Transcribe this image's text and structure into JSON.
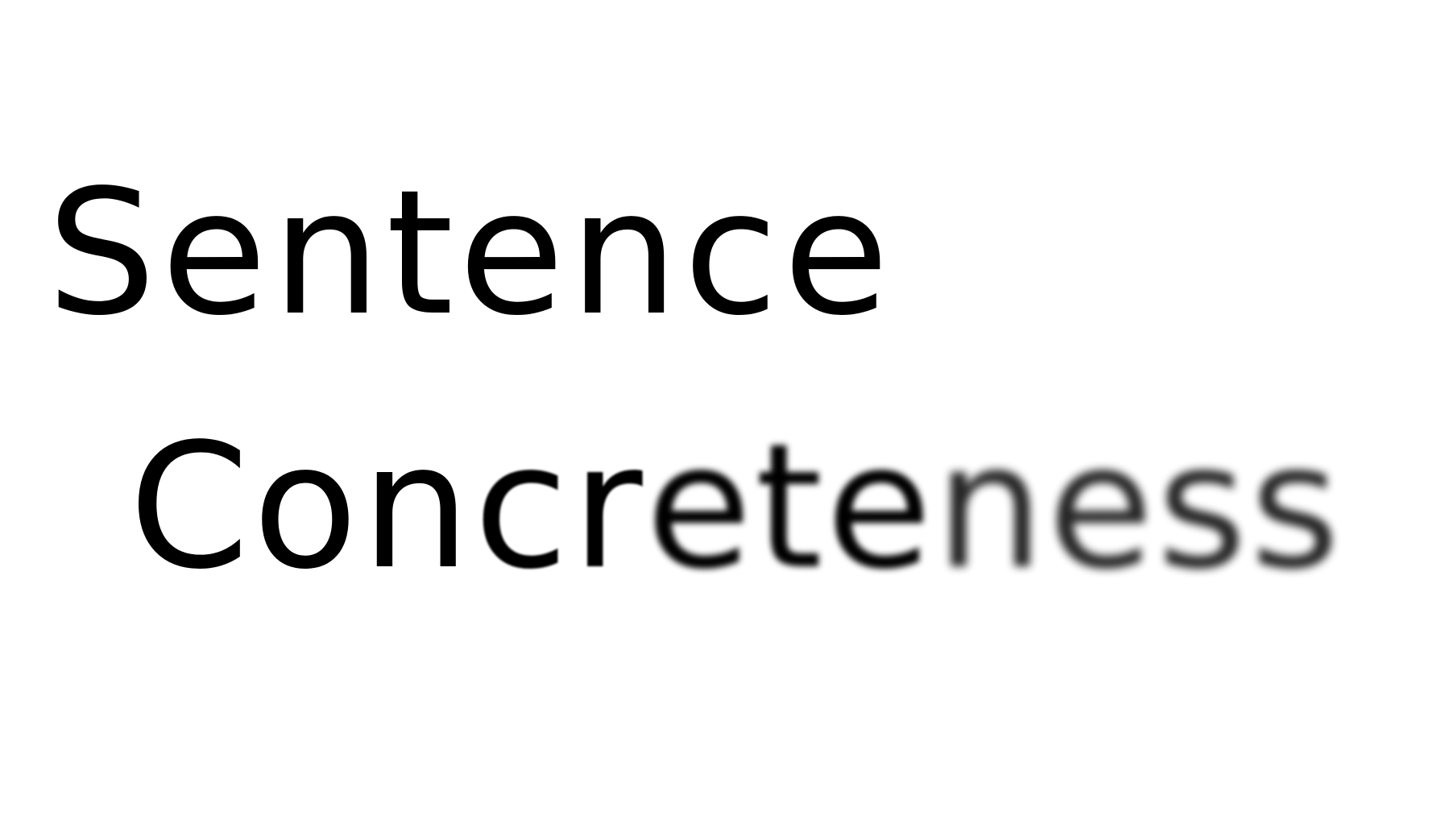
{
  "slide": {
    "line1": "Sentence",
    "line2": {
      "sharp": "Con",
      "soft": "cr",
      "blurred": "ete",
      "very_blurred": "ness"
    }
  }
}
